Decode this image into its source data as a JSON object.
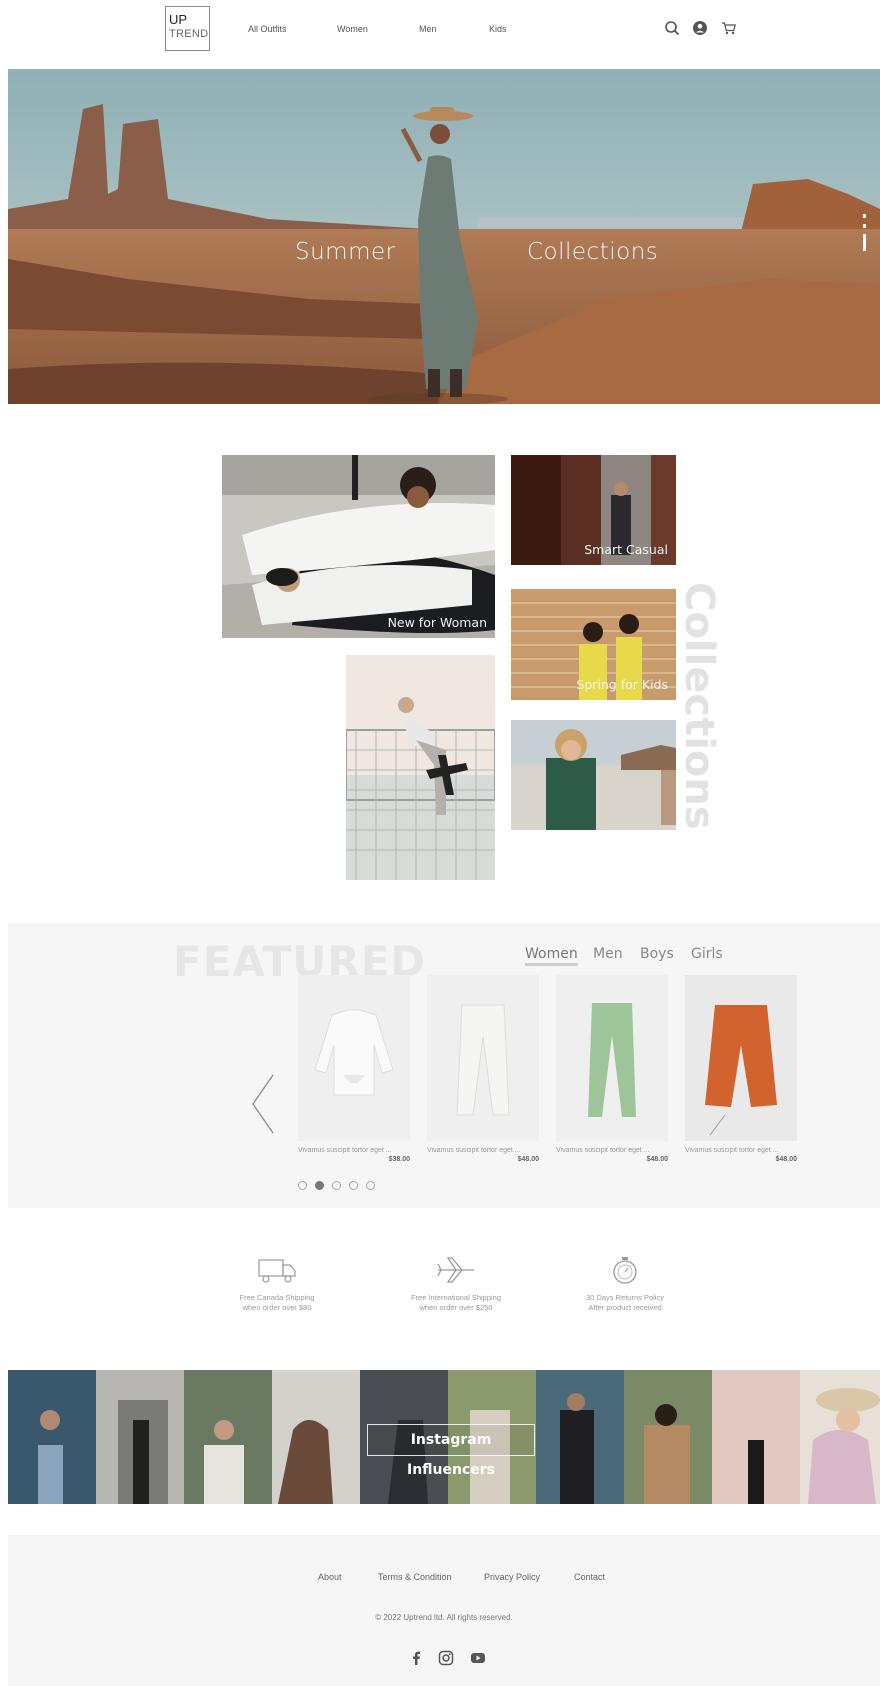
{
  "header": {
    "logo_line1": "UP",
    "logo_line2": "TREND",
    "nav": [
      {
        "label": "All Outfits"
      },
      {
        "label": "Women"
      },
      {
        "label": "Men"
      },
      {
        "label": "Kids"
      }
    ],
    "icons": [
      "search-icon",
      "account-icon",
      "cart-icon"
    ]
  },
  "hero": {
    "left_text": "Summer",
    "right_text": "Collections"
  },
  "collections": {
    "side_title": "Collections",
    "tiles": [
      {
        "label": "New for Woman"
      },
      {
        "label": "Smart Casual"
      },
      {
        "label": "Spring for Kids"
      },
      {
        "label": ""
      },
      {
        "label": ""
      }
    ]
  },
  "featured": {
    "title": "FEATURED",
    "tabs": [
      {
        "label": "Women"
      },
      {
        "label": "Men"
      },
      {
        "label": "Boys"
      },
      {
        "label": "Girls"
      }
    ],
    "active_tab": "Women",
    "products": [
      {
        "name": "Vivamus suscipit tortor eget ...",
        "price": "$38.00",
        "item_color": "#f2f2f2"
      },
      {
        "name": "Vivamus suscipit tortor eget ...",
        "price": "$48.00",
        "item_color": "#ececea"
      },
      {
        "name": "Vivamus suscipit tortor eget ...",
        "price": "$48.00",
        "item_color": "#9ec49a"
      },
      {
        "name": "Vivamus suscipit tortor eget ...",
        "price": "$48.00",
        "item_color": "#d2622e"
      }
    ],
    "pagination": {
      "count": 5,
      "active": 2
    }
  },
  "shipping": [
    {
      "icon": "truck-icon",
      "line1": "Free Canada Shipping",
      "line2": "when order over $80"
    },
    {
      "icon": "airplane-icon",
      "line1": "Free International Shipping",
      "line2": "when order over $250"
    },
    {
      "icon": "stopwatch-icon",
      "line1": "30 Days Returns Policy",
      "line2": "After product received"
    }
  ],
  "instagram": {
    "label": "Instagram Influencers"
  },
  "footer": {
    "links": [
      {
        "label": "About"
      },
      {
        "label": "Terms & Condition"
      },
      {
        "label": "Privacy Policy"
      },
      {
        "label": "Contact"
      }
    ],
    "copyright": "© 2022 Uptrend ltd. All rights reserved.",
    "social": [
      "facebook-icon",
      "instagram-icon",
      "youtube-icon"
    ]
  },
  "colors": {
    "accent": "#777777",
    "footer_bg": "#f6f6f6",
    "featured_bg": "#f6f6f6"
  }
}
